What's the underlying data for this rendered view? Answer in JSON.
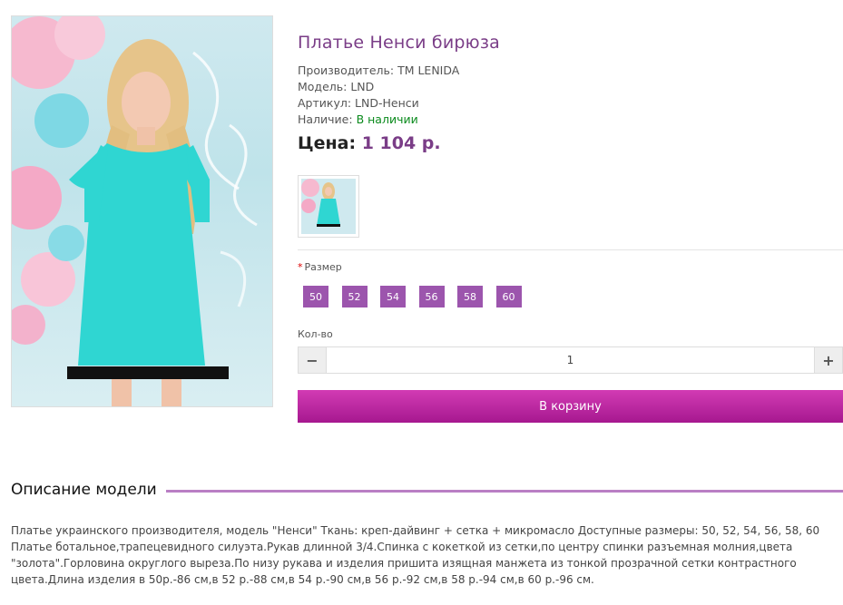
{
  "product": {
    "title": "Платье Ненси бирюза",
    "manufacturer_label": "Производитель:",
    "manufacturer": "TM LENIDA",
    "model_label": "Модель:",
    "model": "LND",
    "sku_label": "Артикул:",
    "sku": "LND-Ненси",
    "availability_label": "Наличие:",
    "availability": "В наличии",
    "price_label": "Цена:",
    "price": "1 104 р."
  },
  "options": {
    "size_label": "Размер",
    "required_mark": "*",
    "sizes": [
      "50",
      "52",
      "54",
      "56",
      "58",
      "60"
    ],
    "qty_label": "Кол-во",
    "qty_minus": "−",
    "qty_plus": "+",
    "qty_value": "1"
  },
  "cart_button": "В корзину",
  "description": {
    "heading": "Описание модели",
    "text": "Платье украинского производителя, модель \"Ненси\" Ткань: креп-дайвинг + сетка + микромасло Доступные размеры: 50, 52, 54, 56, 58, 60 Платье ботальное,трапецевидного силуэта.Рукав длинной 3/4.Спинка с кокеткой из сетки,по центру спинки разъемная молния,цвета \"золота\".Горловина округлого выреза.По низу рукава и изделия пришита изящная манжета из тонкой прозрачной сетки контрастного цвета.Длина изделия в 50р.-86 см,в 52 р.-88 см,в 54 р.-90 см,в 56 р.-92 см,в 58 р.-94 см,в 60 р.-96 см."
  },
  "colors": {
    "accent": "#7a3d87",
    "size_button": "#9c55ad",
    "cart_button": "#c02aa6",
    "in_stock": "#0a8a1c",
    "dress": "#2fd6d2"
  }
}
